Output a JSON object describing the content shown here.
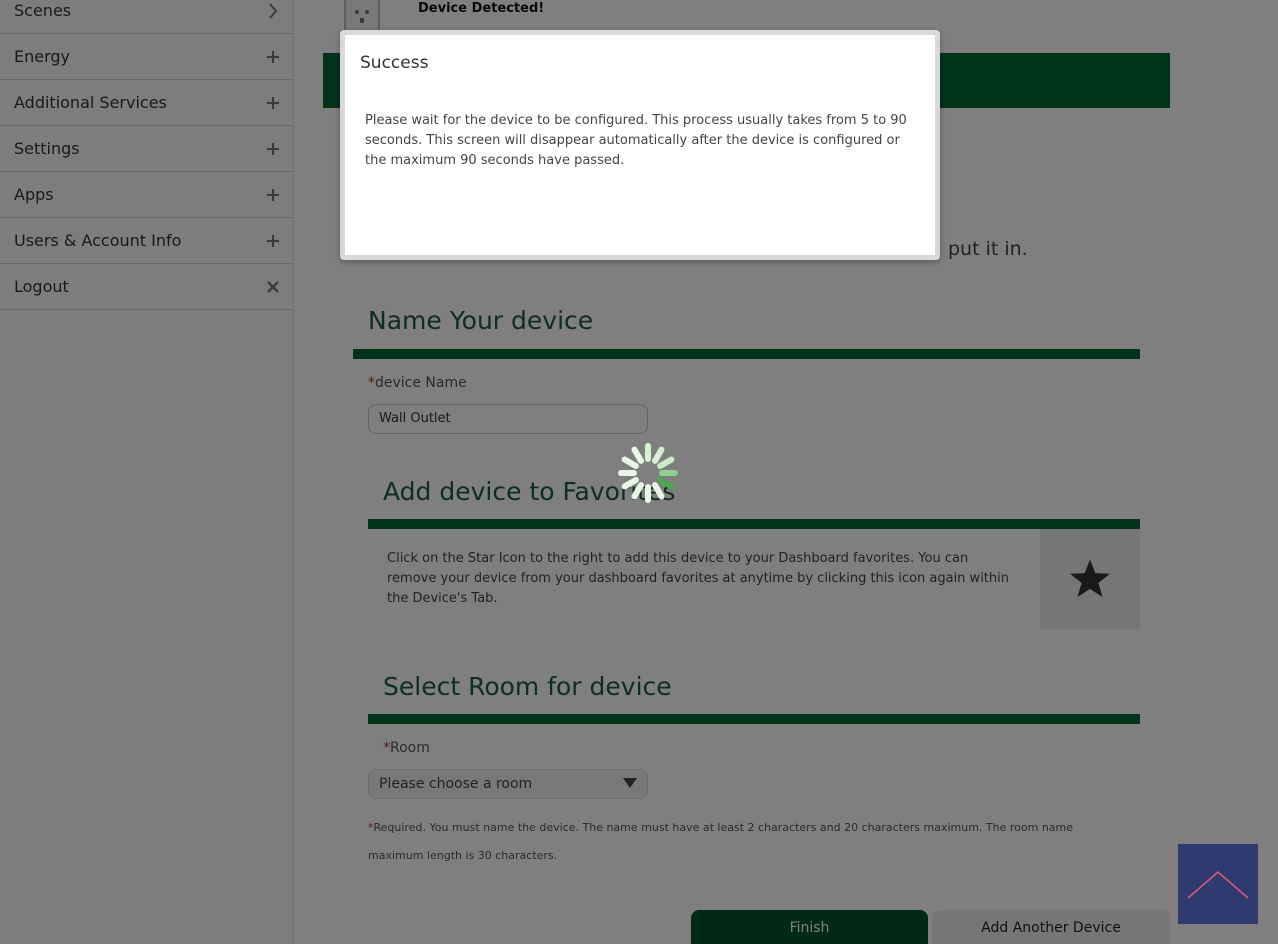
{
  "sidebar": {
    "items": [
      {
        "label": "Scenes",
        "icon": "chevron-right-icon"
      },
      {
        "label": "Energy",
        "icon": "plus-icon"
      },
      {
        "label": "Additional Services",
        "icon": "plus-icon"
      },
      {
        "label": "Settings",
        "icon": "plus-icon"
      },
      {
        "label": "Apps",
        "icon": "plus-icon"
      },
      {
        "label": "Users & Account Info",
        "icon": "plus-icon"
      },
      {
        "label": "Logout",
        "icon": "close-icon"
      }
    ]
  },
  "main": {
    "detected_title": "Device Detected!",
    "instruction_tail": "put it in.",
    "name_section": {
      "title": "Name Your device",
      "required_mark": "*",
      "field_label": "device Name",
      "field_value": "Wall Outlet"
    },
    "favorites_section": {
      "title": "Add device to Favorites",
      "description": "Click on the Star Icon to the right to add this device to your Dashboard favorites. You can remove your device from your dashboard favorites at anytime by clicking this icon again within the Device's Tab."
    },
    "room_section": {
      "title": "Select Room for device",
      "required_mark": "*",
      "field_label": "Room",
      "select_value": "Please choose a room"
    },
    "required_note": {
      "mark": "*",
      "text": "Required. You must name the device. The name must have at least 2 characters and 20 characters maximum. The room name maximum length is 30 characters."
    },
    "buttons": {
      "finish": "Finish",
      "add_another": "Add Another Device"
    }
  },
  "modal": {
    "title": "Success",
    "body": "Please wait for the device to be configured. This process usually takes from 5 to 90 seconds. This screen will disappear automatically after the device is configured or the maximum 90 seconds have passed."
  },
  "colors": {
    "brand_green": "#006633",
    "button_green": "#01552d",
    "overlay": "rgba(0,0,0,0.5)",
    "back_to_top_bg": "#2e3a70",
    "back_to_top_arrow": "#e05a6a"
  }
}
